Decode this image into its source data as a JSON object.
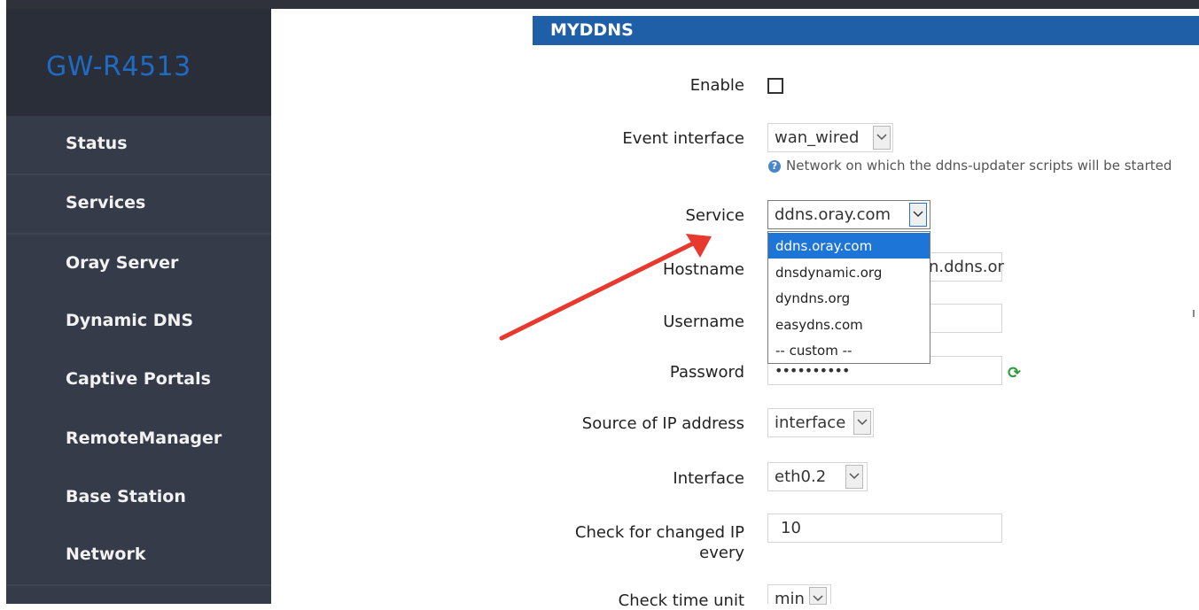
{
  "brand": "GW-R4513",
  "nav": [
    {
      "label": "Status"
    },
    {
      "label": "Services"
    },
    {
      "label": "Oray Server"
    },
    {
      "label": "Dynamic DNS"
    },
    {
      "label": "Captive Portals"
    },
    {
      "label": "RemoteManager"
    },
    {
      "label": "Base Station"
    },
    {
      "label": "Network"
    }
  ],
  "section": {
    "title": "MYDDNS"
  },
  "form": {
    "enable": {
      "label": "Enable",
      "checked": false
    },
    "event_interface": {
      "label": "Event interface",
      "value": "wan_wired",
      "hint": "Network on which the ddns-updater scripts will be started"
    },
    "service": {
      "label": "Service",
      "value": "ddns.oray.com",
      "options": [
        "ddns.oray.com",
        "dnsdynamic.org",
        "dyndns.org",
        "easydns.com",
        "-- custom --"
      ],
      "selected_index": 0
    },
    "hostname": {
      "label": "Hostname",
      "value_visible": "n.ddns.or"
    },
    "username": {
      "label": "Username",
      "value": ""
    },
    "password": {
      "label": "Password",
      "value": "••••••••••"
    },
    "source_ip": {
      "label": "Source of IP address",
      "value": "interface"
    },
    "interface": {
      "label": "Interface",
      "value": "eth0.2"
    },
    "check_changed": {
      "label_line1": "Check for changed IP",
      "label_line2": "every",
      "value": "10"
    },
    "check_unit": {
      "label": "Check time unit",
      "value": "min"
    }
  },
  "icons": {
    "hint": "help-icon",
    "refresh": "refresh-icon",
    "dropdown": "chevron-down-icon",
    "annotation": "red-arrow"
  },
  "colors": {
    "sidebar": "#353b48",
    "brand": "#1e6bc4",
    "section_bar": "#1f5fa8",
    "selected_option": "#1e75d8",
    "arrow": "#e8392f"
  }
}
